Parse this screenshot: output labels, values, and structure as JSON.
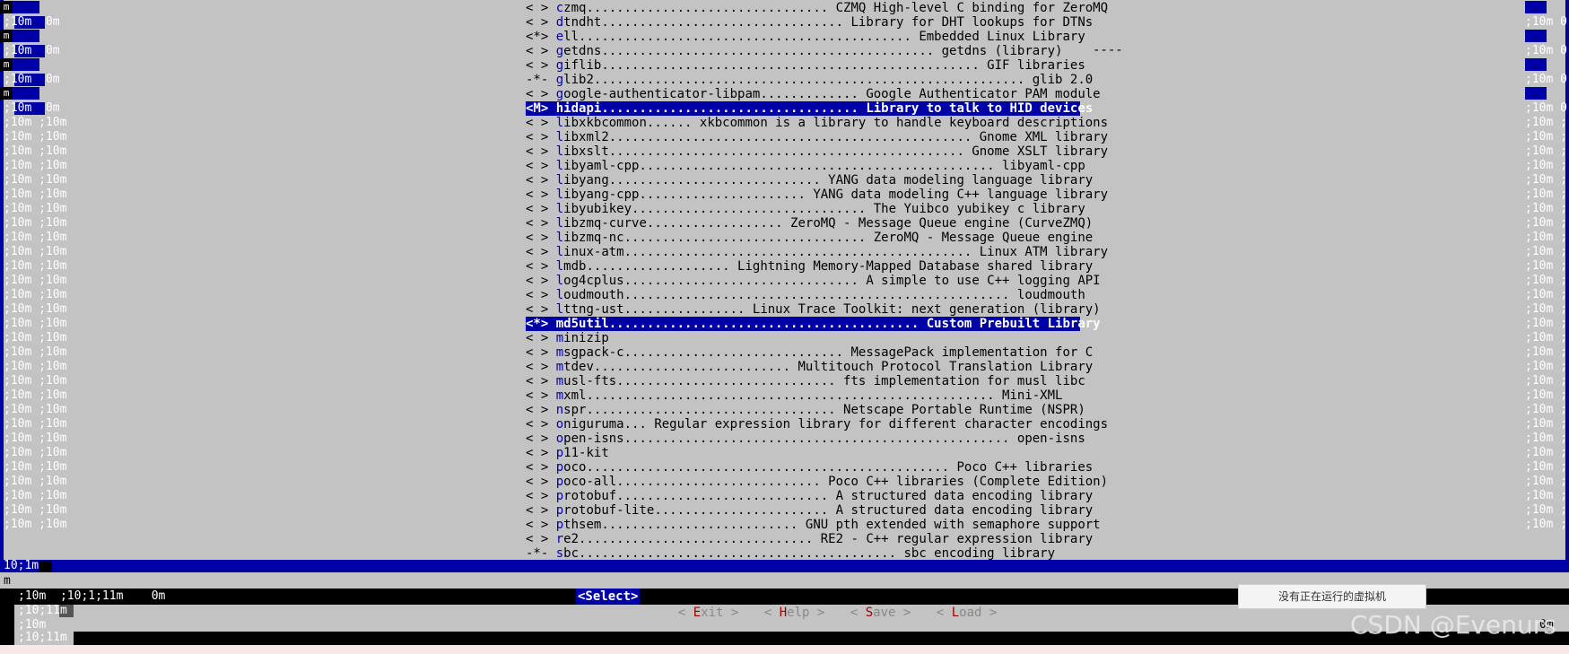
{
  "left_garbage": [
    "m",
    ";10m  0m",
    "m",
    ";10m  0m",
    "m",
    ";10m  0m",
    "m",
    ";10m  0m",
    ";10m ;10m",
    ";10m ;10m",
    ";10m ;10m",
    ";10m ;10m",
    ";10m ;10m",
    ";10m ;10m",
    ";10m ;10m",
    ";10m ;10m",
    ";10m ;10m",
    ";10m ;10m",
    ";10m ;10m",
    ";10m ;10m",
    ";10m ;10m",
    ";10m ;10m",
    ";10m ;10m",
    ";10m ;10m",
    ";10m ;10m",
    ";10m ;10m",
    ";10m ;10m",
    ";10m ;10m",
    ";10m ;10m",
    ";10m ;10m",
    ";10m ;10m",
    ";10m ;10m",
    ";10m ;10m",
    ";10m ;10m",
    ";10m ;10m",
    ";10m ;10m",
    ";10m ;10m"
  ],
  "right_garbage": [
    "",
    ";10m 0",
    "",
    ";10m 0",
    "",
    ";10m 0",
    "",
    ";10m 0",
    ";10m ;",
    ";10m ;",
    ";10m ;",
    ";10m ;",
    ";10m ;",
    ";10m ;",
    ";10m ;",
    ";10m ;",
    ";10m ;",
    ";10m ;",
    ";10m ;",
    ";10m ;",
    ";10m ;",
    ";10m ;",
    ";10m ;",
    ";10m ;",
    ";10m ;",
    ";10m ;",
    ";10m ;",
    ";10m ;",
    ";10m ;",
    ";10m ;",
    ";10m ;",
    ";10m ;",
    ";10m ;",
    ";10m ;",
    ";10m ;",
    ";10m ;",
    ";10m ;"
  ],
  "menu_items": [
    {
      "sel": "< >",
      "hot": "c",
      "rest": "zmq................................ CZMQ High-level C binding for ZeroMQ"
    },
    {
      "sel": "< >",
      "hot": "d",
      "rest": "tndht................................ Library for DHT lookups for DTNs"
    },
    {
      "sel": "<*>",
      "hot": "e",
      "rest": "ll............................................ Embedded Linux Library"
    },
    {
      "sel": "< >",
      "hot": "g",
      "rest": "etdns............................................ getdns (library)"
    },
    {
      "sel": "< >",
      "hot": "g",
      "rest": "iflib.................................................. GIF libraries"
    },
    {
      "sel": "-*-",
      "hot": "g",
      "rest": "lib2......................................................... glib 2.0"
    },
    {
      "sel": "< >",
      "hot": "g",
      "rest": "oogle-authenticator-libpam............. Google Authenticator PAM module"
    },
    {
      "sel": "<M>",
      "hot": "h",
      "rest": "idapi.................................. Library to talk to HID devices",
      "highlight": true
    },
    {
      "sel": "< >",
      "hot": "l",
      "rest": "ibxkbcommon...... xkbcommon is a library to handle keyboard descriptions"
    },
    {
      "sel": "< >",
      "hot": "l",
      "rest": "ibxml2................................................ Gnome XML library"
    },
    {
      "sel": "< >",
      "hot": "l",
      "rest": "ibxslt............................................... Gnome XSLT library"
    },
    {
      "sel": "< >",
      "hot": "l",
      "rest": "ibyaml-cpp............................................... libyaml-cpp"
    },
    {
      "sel": "< >",
      "hot": "l",
      "rest": "ibyang............................ YANG data modeling language library"
    },
    {
      "sel": "< >",
      "hot": "l",
      "rest": "ibyang-cpp...................... YANG data modeling C++ language library"
    },
    {
      "sel": "< >",
      "hot": "l",
      "rest": "ibyubikey............................... The Yuibco yubikey c library"
    },
    {
      "sel": "< >",
      "hot": "l",
      "rest": "ibzmq-curve.................. ZeroMQ - Message Queue engine (CurveZMQ)"
    },
    {
      "sel": "< >",
      "hot": "l",
      "rest": "ibzmq-nc................................ ZeroMQ - Message Queue engine"
    },
    {
      "sel": "< >",
      "hot": "l",
      "rest": "inux-atm.............................................. Linux ATM library"
    },
    {
      "sel": "< >",
      "hot": "l",
      "rest": "mdb................... Lightning Memory-Mapped Database shared library"
    },
    {
      "sel": "< >",
      "hot": "l",
      "rest": "og4cplus............................... A simple to use C++ logging API"
    },
    {
      "sel": "< >",
      "hot": "l",
      "rest": "oudmouth................................................... loudmouth"
    },
    {
      "sel": "< >",
      "hot": "l",
      "rest": "ttng-ust................ Linux Trace Toolkit: next generation (library)"
    },
    {
      "sel": "<*>",
      "hot": "m",
      "rest": "d5util......................................... Custom Prebuilt Library",
      "highlight": true
    },
    {
      "sel": "< >",
      "hot": "m",
      "rest": "inizip"
    },
    {
      "sel": "< >",
      "hot": "m",
      "rest": "sgpack-c............................. MessagePack implementation for C"
    },
    {
      "sel": "< >",
      "hot": "m",
      "rest": "tdev.......................... Multitouch Protocol Translation Library"
    },
    {
      "sel": "< >",
      "hot": "m",
      "rest": "usl-fts............................. fts implementation for musl libc"
    },
    {
      "sel": "< >",
      "hot": "m",
      "rest": "xml...................................................... Mini-XML"
    },
    {
      "sel": "< >",
      "hot": "n",
      "rest": "spr................................. Netscape Portable Runtime (NSPR)"
    },
    {
      "sel": "< >",
      "hot": "o",
      "rest": "niguruma... Regular expression library for different character encodings"
    },
    {
      "sel": "< >",
      "hot": "o",
      "rest": "pen-isns................................................... open-isns"
    },
    {
      "sel": "< >",
      "hot": "p",
      "rest": "11-kit"
    },
    {
      "sel": "< >",
      "hot": "p",
      "rest": "oco................................................ Poco C++ libraries"
    },
    {
      "sel": "< >",
      "hot": "p",
      "rest": "oco-all........................... Poco C++ libraries (Complete Edition)"
    },
    {
      "sel": "< >",
      "hot": "p",
      "rest": "rotobuf............................ A structured data encoding library"
    },
    {
      "sel": "< >",
      "hot": "p",
      "rest": "rotobuf-lite....................... A structured data encoding library"
    },
    {
      "sel": "< >",
      "hot": "p",
      "rest": "thsem.......................... GNU pth extended with semaphore support"
    },
    {
      "sel": "< >",
      "hot": "r",
      "rest": "e2............................... RE2 - C++ regular expression library"
    },
    {
      "sel": "-*-",
      "hot": "s",
      "rest": "bc.......................................... sbc encoding library"
    }
  ],
  "dash_text": "----",
  "status_bar": "10;1m",
  "bottom_left": {
    "l0": "m",
    "l1": ";10m  ;10;1;11m    0m",
    "l2": ";10;11m",
    "l3": ";10m",
    "l4": ";10;11m",
    "r1": "0m"
  },
  "buttons": {
    "select": "<Select>",
    "exit_open": "< ",
    "exit_key": "E",
    "exit_rest": "xit >",
    "help_open": "< ",
    "help_key": "H",
    "help_rest": "elp >",
    "save_open": "< ",
    "save_key": "S",
    "save_rest": "ave >",
    "load_open": "< ",
    "load_key": "L",
    "load_rest": "oad >"
  },
  "popup_text": "没有正在运行的虚拟机",
  "watermark": "CSDN @Evenurs",
  "colors": {
    "terminal_bg": "#c3c3c3",
    "blue": "#0000a8",
    "black": "#000000",
    "hotkey_red": "#a00000"
  }
}
